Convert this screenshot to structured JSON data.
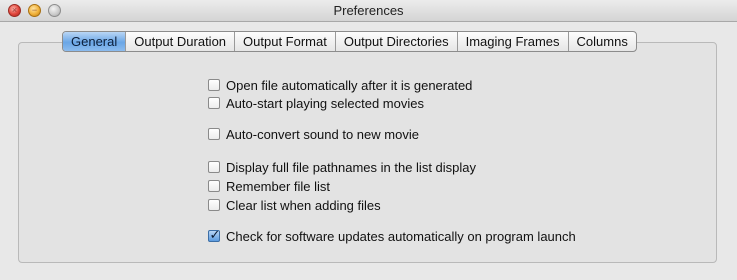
{
  "window": {
    "title": "Preferences"
  },
  "tabs": [
    {
      "label": "General",
      "active": true
    },
    {
      "label": "Output Duration",
      "active": false
    },
    {
      "label": "Output Format",
      "active": false
    },
    {
      "label": "Output Directories",
      "active": false
    },
    {
      "label": "Imaging Frames",
      "active": false
    },
    {
      "label": "Columns",
      "active": false
    }
  ],
  "options": [
    {
      "label": "Open file automatically after it is generated",
      "checked": false
    },
    {
      "label": "Auto-start playing selected movies",
      "checked": false
    },
    {
      "label": "Auto-convert sound to new movie",
      "checked": false
    },
    {
      "label": "Display full file pathnames in the list display",
      "checked": false
    },
    {
      "label": "Remember file list",
      "checked": false
    },
    {
      "label": "Clear list when adding files",
      "checked": false
    },
    {
      "label": "Check for software updates automatically on program launch",
      "checked": true
    }
  ],
  "colors": {
    "active_tab": "#6aa6e6",
    "close_button": "#e0443a",
    "minimize_button": "#f0b13a",
    "zoom_button": "#c9c9c9"
  }
}
